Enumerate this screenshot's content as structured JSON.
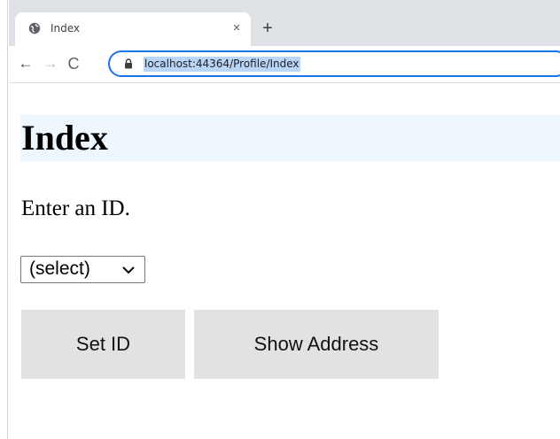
{
  "browser": {
    "tab": {
      "title": "Index",
      "favicon": "globe-icon",
      "close_glyph": "×"
    },
    "new_tab_glyph": "+",
    "toolbar": {
      "back_glyph": "←",
      "forward_glyph": "→",
      "reload_glyph": "C",
      "url": "localhost:44364/Profile/Index"
    }
  },
  "page": {
    "title": "Index",
    "instruction": "Enter an ID.",
    "select": {
      "selected": "(select)"
    },
    "buttons": {
      "set_id": "Set ID",
      "show_address": "Show Address"
    }
  },
  "colors": {
    "tabstrip_bg": "#dee1e6",
    "omnibox_focus": "#1a73e8",
    "url_selection": "#b9d5f8",
    "header_band": "#eef7fd",
    "button_bg": "#e2e2e2"
  }
}
